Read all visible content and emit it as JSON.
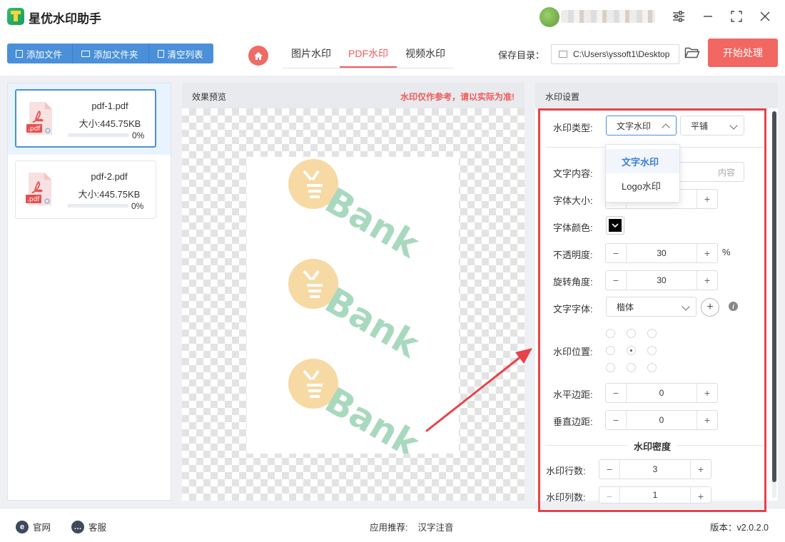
{
  "app": {
    "title": "星优水印助手"
  },
  "toolbar": {
    "add_file": "添加文件",
    "add_folder": "添加文件夹",
    "clear_list": "清空列表",
    "tabs": [
      "图片水印",
      "PDF水印",
      "视频水印"
    ],
    "active_tab": "PDF水印",
    "save_label": "保存目录：",
    "save_path": "C:\\Users\\yssoft1\\Desktop",
    "start_label": "开始处理"
  },
  "files": [
    {
      "name": "pdf-1.pdf",
      "size": "大小:445.75KB",
      "progress": 0,
      "progress_text": "0%",
      "badge": ".pdf"
    },
    {
      "name": "pdf-2.pdf",
      "size": "大小:445.75KB",
      "progress": 0,
      "progress_text": "0%",
      "badge": ".pdf"
    }
  ],
  "preview": {
    "title": "效果预览",
    "warning": "水印仅作参考，请以实际为准!",
    "watermark_text": "Bank",
    "watermark_count": 3
  },
  "settings": {
    "title": "水印设置",
    "type_label": "水印类型:",
    "type_value": "文字水印",
    "layout_value": "平铺",
    "type_options": [
      "文字水印",
      "Logo水印"
    ],
    "text_label": "文字内容:",
    "text_placeholder": "内容",
    "font_size_label": "字体大小:",
    "font_color_label": "字体颜色:",
    "font_color": "#000000",
    "opacity_label": "不透明度:",
    "opacity_value": "30",
    "opacity_unit": "%",
    "rotation_label": "旋转角度:",
    "rotation_value": "30",
    "font_label": "文字字体:",
    "font_value": "楷体",
    "position_label": "水印位置:",
    "position_selected": 4,
    "h_margin_label": "水平边距:",
    "h_margin_value": "0",
    "v_margin_label": "垂直边距:",
    "v_margin_value": "0",
    "density_title": "水印密度",
    "rows_label": "水印行数:",
    "rows_value": "3",
    "cols_label": "水印列数:",
    "cols_value": "1"
  },
  "status": {
    "website": "官网",
    "support": "客服",
    "recommend_label": "应用推荐:",
    "recommend_value": "汉字注音",
    "version": "版本：v2.0.2.0"
  },
  "colors": {
    "accent_blue": "#4a90d9",
    "accent_red": "#ef5a5a",
    "start_button": "#f26762",
    "frame_red": "#e8424b",
    "watermark_circle": "#f6d9a3",
    "watermark_text": "#a8d9bf"
  }
}
